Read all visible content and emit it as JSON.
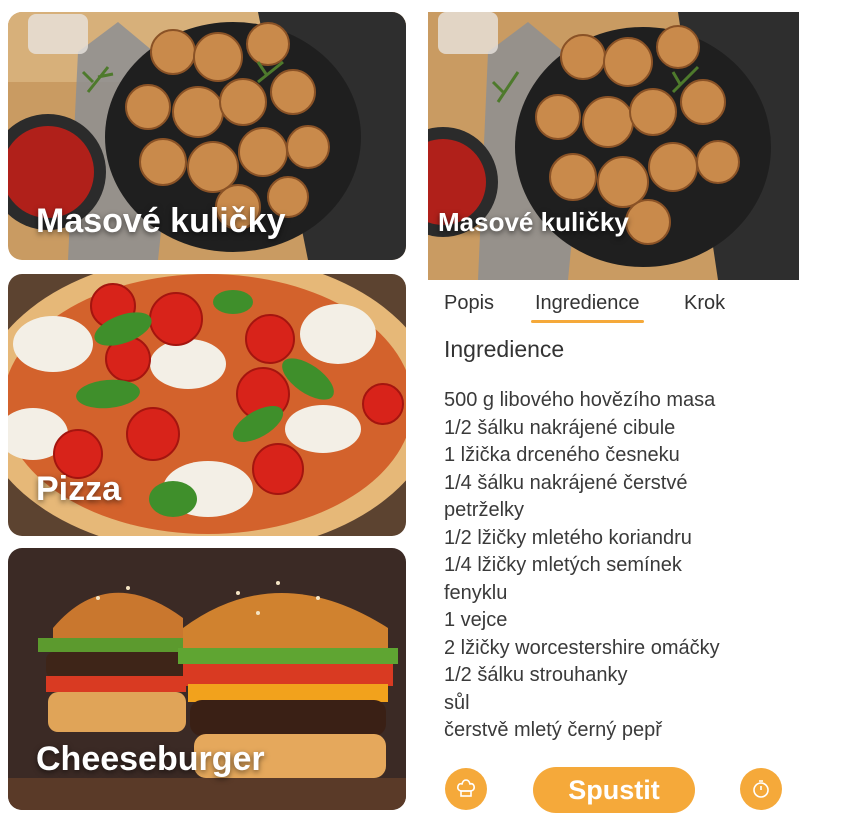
{
  "recipes": [
    {
      "title": "Masové kuličky"
    },
    {
      "title": "Pizza"
    },
    {
      "title": "Cheeseburger"
    }
  ],
  "detail": {
    "title": "Masové kuličky",
    "tabs": [
      {
        "label": "Popis",
        "active": false
      },
      {
        "label": "Ingredience",
        "active": true
      },
      {
        "label": "Krok",
        "active": false
      }
    ],
    "section_heading": "Ingredience",
    "ingredients": [
      "500 g libového hovězího masa",
      "1/2 šálku nakrájené cibule",
      "1 lžička drceného česneku",
      "1/4 šálku nakrájené čerstvé",
      "petrželky",
      "1/2 lžičky mletého koriandru",
      "1/4 lžičky mletých semínek",
      "fenyklu",
      "1 vejce",
      "2 lžičky worcestershire omáčky",
      "1/2 šálku strouhanky",
      "sůl",
      "čerstvě mletý černý pepř"
    ],
    "start_label": "Spustit",
    "left_button_icon": "chef-hat-icon",
    "right_button_icon": "timer-icon"
  },
  "colors": {
    "accent": "#f5a93a",
    "text": "#3a3a3a"
  }
}
